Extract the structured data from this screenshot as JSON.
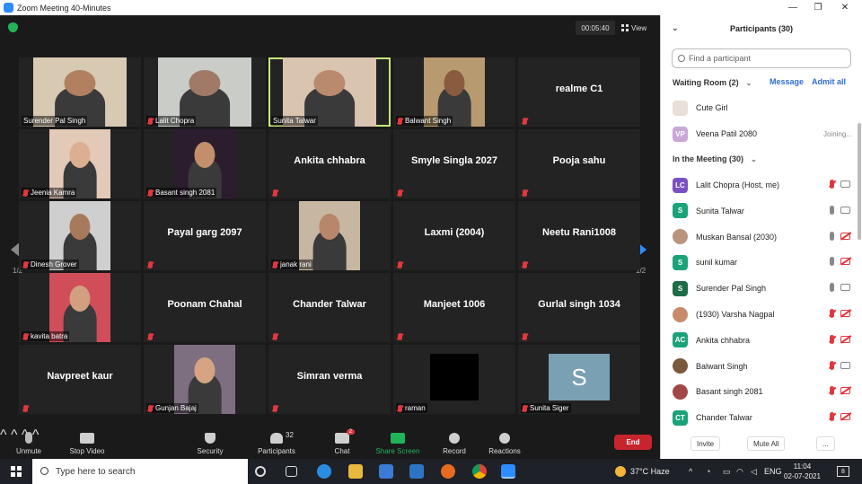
{
  "window": {
    "title": "Zoom Meeting 40-Minutes"
  },
  "topbar": {
    "timer": "00:05:40",
    "view_label": "View"
  },
  "tiles": [
    {
      "name": "Surender Pal Singh",
      "video": true,
      "muted": false,
      "skin": "#b08060",
      "bg": "#d8c9b2"
    },
    {
      "name": "Lalit Chopra",
      "video": true,
      "muted": true,
      "skin": "#a07a66",
      "bg": "#c9ccc7"
    },
    {
      "name": "Sunita Talwar",
      "video": true,
      "muted": false,
      "active": true,
      "skin": "#b98a6d",
      "bg": "#d9c4b0"
    },
    {
      "name": "Balwant Singh",
      "video": true,
      "muted": true,
      "skin": "#8a5b3f",
      "bg": "#b79a6f"
    },
    {
      "name": "realme C1",
      "video": false,
      "muted": true
    },
    {
      "name": "Jeenia Kamra",
      "video": true,
      "muted": true,
      "skin": "#dcae92",
      "bg": "#e3c9b8"
    },
    {
      "name": "Basant singh 2081",
      "video": true,
      "muted": true,
      "skin": "#c38e6b",
      "bg": "#2b1d2e"
    },
    {
      "name": "Ankita chhabra",
      "video": false,
      "muted": true
    },
    {
      "name": "Smyle Singla 2027",
      "video": false,
      "muted": true
    },
    {
      "name": "Pooja sahu",
      "video": false,
      "muted": true
    },
    {
      "name": "Dinesh Grover",
      "video": true,
      "muted": true,
      "skin": "#a87a5d",
      "bg": "#cfcfcf"
    },
    {
      "name": "Payal garg 2097",
      "video": false,
      "muted": true
    },
    {
      "name": "janak rani",
      "video": true,
      "muted": true,
      "skin": "#b8866a",
      "bg": "#c7b7a2"
    },
    {
      "name": "Laxmi (2004)",
      "video": false,
      "muted": true
    },
    {
      "name": "Neetu Rani1008",
      "video": false,
      "muted": true
    },
    {
      "name": "kavita batra",
      "video": true,
      "muted": true,
      "skin": "#d2a080",
      "bg": "#d04d5a"
    },
    {
      "name": "Poonam Chahal",
      "video": false,
      "muted": true
    },
    {
      "name": "Chander Talwar",
      "video": false,
      "muted": true
    },
    {
      "name": "Manjeet 1006",
      "video": false,
      "muted": true
    },
    {
      "name": "Gurlal singh 1034",
      "video": false,
      "muted": true
    },
    {
      "name": "Navpreet kaur",
      "video": false,
      "muted": true
    },
    {
      "name": "Gunjan Bajaj",
      "video": true,
      "muted": true,
      "skin": "#d6a483",
      "bg": "#7d6f80"
    },
    {
      "name": "Simran verma",
      "video": false,
      "muted": true
    },
    {
      "name": "raman",
      "video": true,
      "muted": true,
      "skin": "#000000",
      "bg": "#000000"
    },
    {
      "name": "Sunita Siger",
      "video": true,
      "muted": true,
      "letter": "S",
      "bg": "#7aa0b4"
    }
  ],
  "nav": {
    "page_left": "1/2",
    "page_right": "1/2"
  },
  "toolbar": {
    "unmute": "Unmute",
    "stop_video": "Stop Video",
    "security": "Security",
    "participants": "Participants",
    "participants_count": "32",
    "chat": "Chat",
    "chat_badge": "2",
    "share_screen": "Share Screen",
    "record": "Record",
    "reactions": "Reactions",
    "end": "End"
  },
  "panel": {
    "title": "Participants (30)",
    "search_placeholder": "Find a participant",
    "waiting_room": "Waiting Room (2)",
    "message": "Message",
    "admit_all": "Admit all",
    "waiting": [
      {
        "name": "Cute Girl",
        "avatar_bg": "#e8e0d8",
        "initials": ""
      },
      {
        "name": "Veena Patil 2080",
        "initials": "VP",
        "avatar_bg": "#c9a8d8",
        "status": "Joining..."
      }
    ],
    "in_meeting_label": "In the Meeting (30)",
    "members": [
      {
        "name": "Lalit Chopra (Host, me)",
        "initials": "LC",
        "avatar_bg": "#7b4fc4",
        "mic_off": true,
        "vid_off": false
      },
      {
        "name": "Sunita Talwar",
        "initials": "S",
        "avatar_bg": "#1aa37a",
        "mic_off": false,
        "vid_off": false
      },
      {
        "name": "Muskan Bansal (2030)",
        "initials": "",
        "avatar_bg": "#b9957c",
        "mic_off": false,
        "vid_off": true
      },
      {
        "name": "sunil kumar",
        "initials": "S",
        "avatar_bg": "#1aa37a",
        "mic_off": false,
        "vid_off": true
      },
      {
        "name": "Surender Pal Singh",
        "initials": "S",
        "avatar_bg": "#1e6b47",
        "mic_off": false,
        "vid_off": false
      },
      {
        "name": "(1930) Varsha Nagpal",
        "initials": "",
        "avatar_bg": "#c78c6b",
        "mic_off": true,
        "vid_off": true
      },
      {
        "name": "Ankita chhabra",
        "initials": "AC",
        "avatar_bg": "#1aa37a",
        "mic_off": true,
        "vid_off": true
      },
      {
        "name": "Balwant Singh",
        "initials": "",
        "avatar_bg": "#7a5a3c",
        "mic_off": true,
        "vid_off": false
      },
      {
        "name": "Basant singh 2081",
        "initials": "",
        "avatar_bg": "#a04848",
        "mic_off": true,
        "vid_off": true
      },
      {
        "name": "Chander Talwar",
        "initials": "CT",
        "avatar_bg": "#1aa37a",
        "mic_off": true,
        "vid_off": true
      }
    ],
    "invite": "Invite",
    "mute_all": "Mute All",
    "more": "..."
  },
  "taskbar": {
    "search_placeholder": "Type here to search",
    "weather": "37°C  Haze",
    "lang": "ENG",
    "time": "11:04",
    "date": "02-07-2021",
    "notif_count": "8"
  }
}
